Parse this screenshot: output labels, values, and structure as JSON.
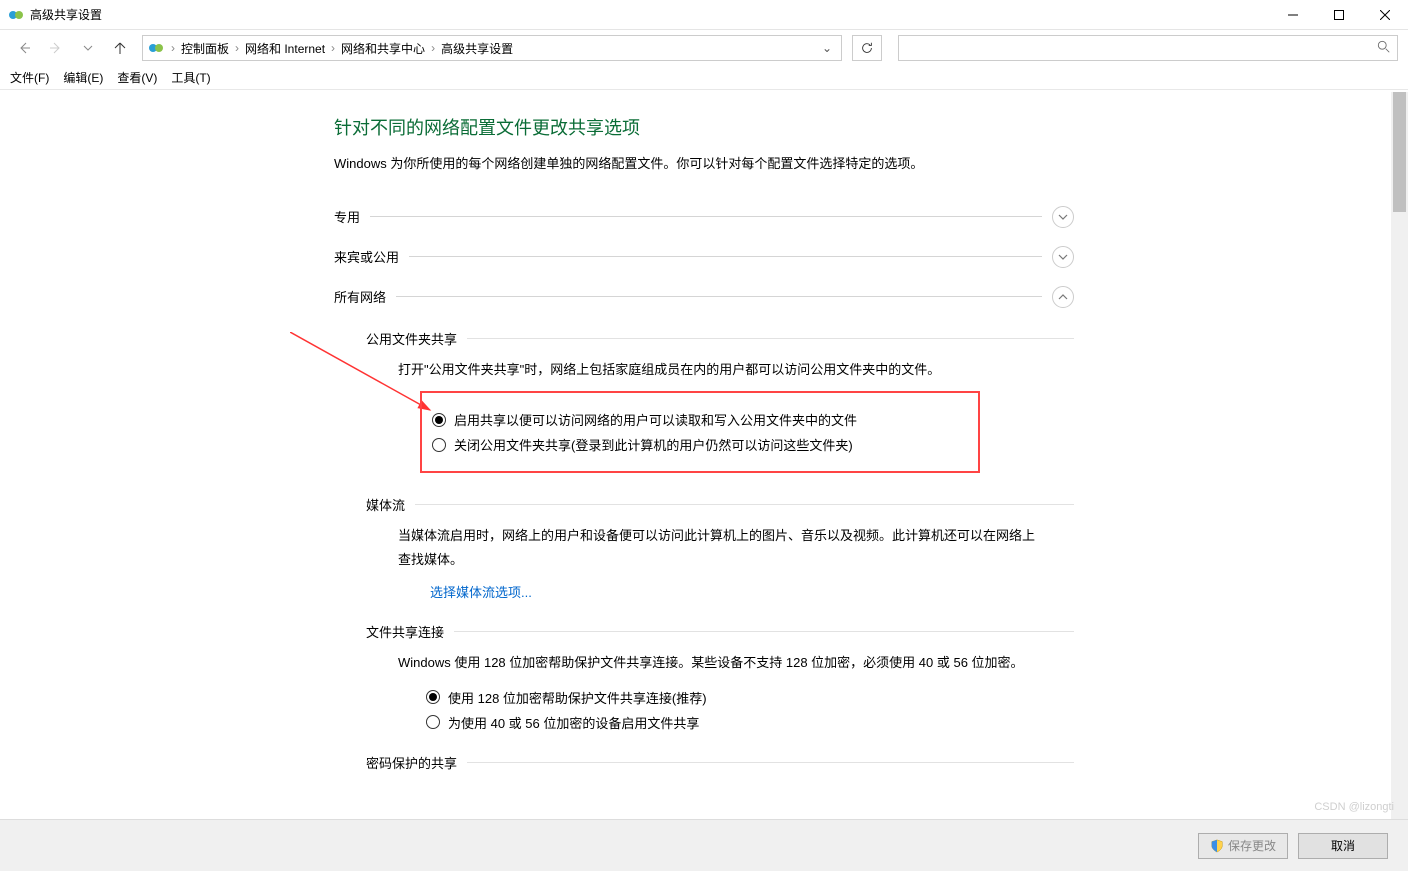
{
  "window": {
    "title": "高级共享设置"
  },
  "breadcrumb": {
    "items": [
      "控制面板",
      "网络和 Internet",
      "网络和共享中心",
      "高级共享设置"
    ]
  },
  "menubar": {
    "file": "文件(F)",
    "edit": "编辑(E)",
    "view": "查看(V)",
    "tools": "工具(T)"
  },
  "page": {
    "title": "针对不同的网络配置文件更改共享选项",
    "desc": "Windows 为你所使用的每个网络创建单独的网络配置文件。你可以针对每个配置文件选择特定的选项。"
  },
  "sections": {
    "private": {
      "label": "专用"
    },
    "guest": {
      "label": "来宾或公用"
    },
    "all": {
      "label": "所有网络"
    }
  },
  "publicFolder": {
    "title": "公用文件夹共享",
    "desc": "打开\"公用文件夹共享\"时，网络上包括家庭组成员在内的用户都可以访问公用文件夹中的文件。",
    "opt1": "启用共享以便可以访问网络的用户可以读取和写入公用文件夹中的文件",
    "opt2": "关闭公用文件夹共享(登录到此计算机的用户仍然可以访问这些文件夹)"
  },
  "media": {
    "title": "媒体流",
    "desc": "当媒体流启用时，网络上的用户和设备便可以访问此计算机上的图片、音乐以及视频。此计算机还可以在网络上查找媒体。",
    "link": "选择媒体流选项..."
  },
  "fileconn": {
    "title": "文件共享连接",
    "desc": "Windows 使用 128 位加密帮助保护文件共享连接。某些设备不支持 128 位加密，必须使用 40 或 56 位加密。",
    "opt1": "使用 128 位加密帮助保护文件共享连接(推荐)",
    "opt2": "为使用 40 或 56 位加密的设备启用文件共享"
  },
  "password": {
    "title": "密码保护的共享"
  },
  "footer": {
    "save": "保存更改",
    "cancel": "取消"
  },
  "watermark": "CSDN @lizongti"
}
